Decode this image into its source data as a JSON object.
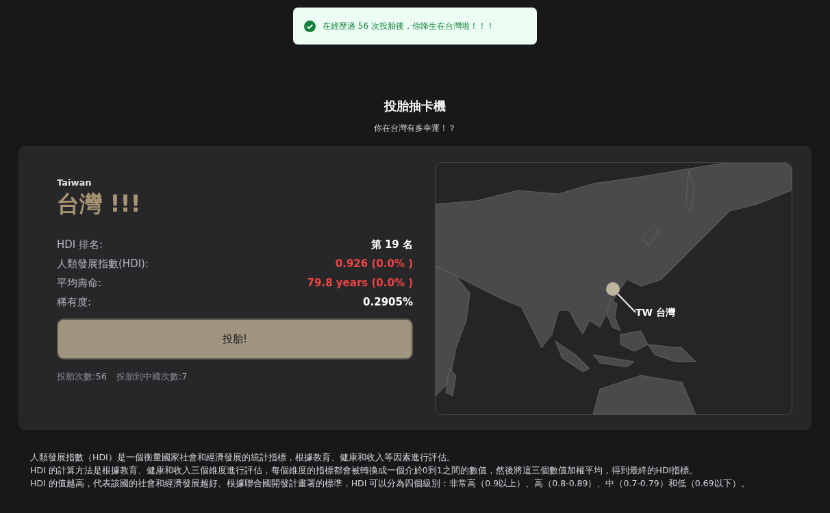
{
  "toast": {
    "message": "在經歷過 56 次投胎後，你降生在台灣啦！！！"
  },
  "header": {
    "title": "投胎抽卡機",
    "subtitle": "你在台灣有多幸運！？"
  },
  "result": {
    "country_en": "Taiwan",
    "country_name": "台灣 !!!",
    "stats": [
      {
        "label": "HDI 排名:",
        "value": "第 19 名",
        "color": "#ffffff"
      },
      {
        "label": "人類發展指數(HDI):",
        "value": "0.926 (0.0% )",
        "color": "#ef4444"
      },
      {
        "label": "平均壽命:",
        "value": "79.8 years (0.0% )",
        "color": "#ef4444"
      },
      {
        "label": "稀有度:",
        "value": "0.2905%",
        "color": "#ffffff"
      }
    ],
    "button": "投胎!",
    "counters": [
      {
        "label": "投胎次數:",
        "value": "56"
      },
      {
        "label": "投胎到中國次數:",
        "value": "7"
      }
    ]
  },
  "map": {
    "marker_label": "TW 台灣"
  },
  "notes": [
    "人類發展指數（HDI）是一個衡量國家社會和經濟發展的統計指標，根據教育、健康和收入等因素進行評估。",
    "HDI 的計算方法是根據教育、健康和收入三個維度進行評估，每個維度的指標都會被轉換成一個介於0到1之間的數值，然後將這三個數值加權平均，得到最終的HDI指標。",
    "HDI 的值越高，代表該國的社會和經濟發展越好。根據聯合國開發計畫署的標準，HDI 可以分為四個級別：非常高（0.9以上）、高（0.8-0.89）、中（0.7-0.79）和低（0.69以下）。"
  ]
}
